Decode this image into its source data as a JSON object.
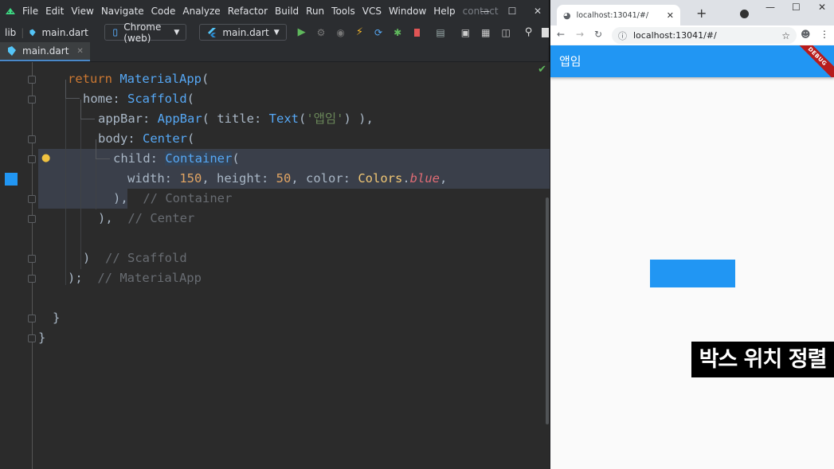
{
  "ide": {
    "menu": [
      "File",
      "Edit",
      "View",
      "Navigate",
      "Code",
      "Analyze",
      "Refactor",
      "Build",
      "Run",
      "Tools",
      "VCS",
      "Window",
      "Help"
    ],
    "project_name": "contact",
    "breadcrumb": [
      "lib",
      "main.dart"
    ],
    "device_selector": "Chrome (web)",
    "run_config": "main.dart",
    "open_tab": "main.dart",
    "code_lines": [
      {
        "t": "return MaterialApp("
      },
      {
        "t": "home: Scaffold("
      },
      {
        "t": "appBar: AppBar( title: Text('앱임') ),"
      },
      {
        "t": "body: Center("
      },
      {
        "t": "child: Container("
      },
      {
        "t": "width: 150, height: 50, color: Colors.blue,"
      },
      {
        "t": "),  // Container"
      },
      {
        "t": "),  // Center"
      },
      {
        "t": ")  // Scaffold"
      },
      {
        "t": ");  // MaterialApp"
      },
      {
        "t": "}"
      },
      {
        "t": "}"
      }
    ]
  },
  "browser": {
    "tab_title": "localhost:13041/#/",
    "url": "localhost:13041/#/",
    "app_title": "앱임",
    "debug_banner": "DEBUG",
    "box": {
      "width": 150,
      "height": 50,
      "color": "#2196f3"
    }
  },
  "caption": "박스 위치 정렬",
  "colors": {
    "accent": "#2196f3",
    "ide_bg": "#2b2b2b"
  }
}
